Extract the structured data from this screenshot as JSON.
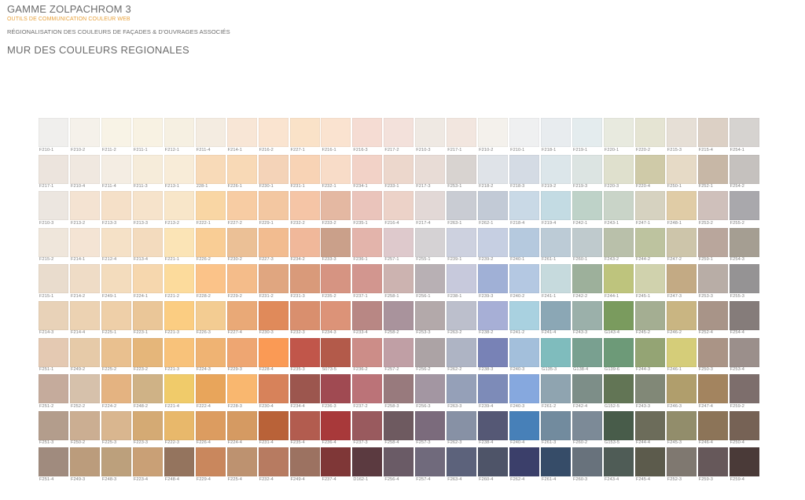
{
  "header": {
    "title": "GAMME ZOLPACHROM 3",
    "subtitle": "OUTILS DE COMMUNICATION COULEUR WEB",
    "description": "RÉGIONALISATION DES COULEURS DE FAÇADES & D'OUVRAGES ASSOCIÉS"
  },
  "section_title": "MUR DES COULEURS REGIONALES",
  "rows": [
    [
      {
        "code": "F210-1",
        "color": "#f0efed"
      },
      {
        "code": "F210-2",
        "color": "#f5f1ea"
      },
      {
        "code": "F211-2",
        "color": "#f8f3e6"
      },
      {
        "code": "F211-1",
        "color": "#f8f2e3"
      },
      {
        "code": "F212-1",
        "color": "#f6f0e2"
      },
      {
        "code": "F211-4",
        "color": "#f4ece1"
      },
      {
        "code": "F214-1",
        "color": "#f8e6d6"
      },
      {
        "code": "F216-2",
        "color": "#fae4d0"
      },
      {
        "code": "F227-1",
        "color": "#fae2c8"
      },
      {
        "code": "F216-1",
        "color": "#fae3d0"
      },
      {
        "code": "F216-3",
        "color": "#f5dcd3"
      },
      {
        "code": "F217-2",
        "color": "#f3e1db"
      },
      {
        "code": "F210-3",
        "color": "#efe9e3"
      },
      {
        "code": "F217-1",
        "color": "#f2e6df"
      },
      {
        "code": "F210-2",
        "color": "#f4f1ec"
      },
      {
        "code": "F210-1",
        "color": "#eff0f1"
      },
      {
        "code": "F218-1",
        "color": "#e8ecef"
      },
      {
        "code": "F219-1",
        "color": "#e4ecee"
      },
      {
        "code": "F220-1",
        "color": "#e8eadf"
      },
      {
        "code": "F220-2",
        "color": "#e5e4d3"
      },
      {
        "code": "F215-3",
        "color": "#e6dfd6"
      },
      {
        "code": "F215-4",
        "color": "#dcd0c5"
      },
      {
        "code": "F254-1",
        "color": "#d6d3d0"
      }
    ],
    [
      {
        "code": "F217-1",
        "color": "#ece4dd"
      },
      {
        "code": "F210-4",
        "color": "#f0e8e0"
      },
      {
        "code": "F211-4",
        "color": "#f4ede3"
      },
      {
        "code": "F211-3",
        "color": "#f6ecda"
      },
      {
        "code": "F213-1",
        "color": "#f8ecd8"
      },
      {
        "code": "228-1",
        "color": "#f8dab8"
      },
      {
        "code": "F226-1",
        "color": "#f8d9b6"
      },
      {
        "code": "F230-1",
        "color": "#f4d3b8"
      },
      {
        "code": "F231-1",
        "color": "#f8d3b5"
      },
      {
        "code": "F232-1",
        "color": "#f8dcc8"
      },
      {
        "code": "F234-1",
        "color": "#f2d2c7"
      },
      {
        "code": "F233-1",
        "color": "#ecd7cc"
      },
      {
        "code": "F217-3",
        "color": "#e8dcd6"
      },
      {
        "code": "F253-1",
        "color": "#d8d3d0"
      },
      {
        "code": "F218-2",
        "color": "#dfe3e8"
      },
      {
        "code": "F218-3",
        "color": "#d4dbe4"
      },
      {
        "code": "F219-2",
        "color": "#dce6ea"
      },
      {
        "code": "F219-3",
        "color": "#dce4e2"
      },
      {
        "code": "F220-3",
        "color": "#dfe0cd"
      },
      {
        "code": "F220-4",
        "color": "#cfcaa8"
      },
      {
        "code": "F250-1",
        "color": "#e6dac6"
      },
      {
        "code": "F252-1",
        "color": "#c7b7a6"
      },
      {
        "code": "F254-2",
        "color": "#c5c1be"
      }
    ],
    [
      {
        "code": "F210-3",
        "color": "#ece6e0"
      },
      {
        "code": "F213-2",
        "color": "#f4e3d2"
      },
      {
        "code": "F213-3",
        "color": "#f5e0c8"
      },
      {
        "code": "F213-3",
        "color": "#f6e3cb"
      },
      {
        "code": "F213-2",
        "color": "#f8e6c9"
      },
      {
        "code": "F222-1",
        "color": "#f9d6a4"
      },
      {
        "code": "F227-2",
        "color": "#f7cca3"
      },
      {
        "code": "F229-1",
        "color": "#f3c7a1"
      },
      {
        "code": "F232-2",
        "color": "#f5c5a6"
      },
      {
        "code": "F233-2",
        "color": "#e4b8a2"
      },
      {
        "code": "F235-1",
        "color": "#eac4bb"
      },
      {
        "code": "F216-4",
        "color": "#ecd2c8"
      },
      {
        "code": "F217-4",
        "color": "#e2d8d6"
      },
      {
        "code": "F263-1",
        "color": "#c9ccd3"
      },
      {
        "code": "F262-1",
        "color": "#c2cad6"
      },
      {
        "code": "F218-4",
        "color": "#c9d9e6"
      },
      {
        "code": "F219-4",
        "color": "#c3dbe3"
      },
      {
        "code": "F242-1",
        "color": "#bed2c8"
      },
      {
        "code": "F243-1",
        "color": "#c9d4c8"
      },
      {
        "code": "F247-1",
        "color": "#d6d2c0"
      },
      {
        "code": "F248-1",
        "color": "#e0cca6"
      },
      {
        "code": "F253-2",
        "color": "#cfc0bb"
      },
      {
        "code": "F255-2",
        "color": "#a9a8ac"
      }
    ],
    [
      {
        "code": "F215-2",
        "color": "#efe6db"
      },
      {
        "code": "F214-1",
        "color": "#f4e4d4"
      },
      {
        "code": "F212-4",
        "color": "#f5e1c7"
      },
      {
        "code": "F213-4",
        "color": "#f3dbbe"
      },
      {
        "code": "F221-1",
        "color": "#fbe4b6"
      },
      {
        "code": "F226-2",
        "color": "#f9cd95"
      },
      {
        "code": "F230-2",
        "color": "#ebc096"
      },
      {
        "code": "F227-3",
        "color": "#f2bc90"
      },
      {
        "code": "F234-2",
        "color": "#f0b89a"
      },
      {
        "code": "F233-3",
        "color": "#caa08a"
      },
      {
        "code": "F236-1",
        "color": "#e3b4ab"
      },
      {
        "code": "F257-1",
        "color": "#dec9cc"
      },
      {
        "code": "F255-1",
        "color": "#d5d2d4"
      },
      {
        "code": "F239-1",
        "color": "#cdd1df"
      },
      {
        "code": "F239-2",
        "color": "#c6cfe2"
      },
      {
        "code": "F240-1",
        "color": "#b5c9de"
      },
      {
        "code": "F261-1",
        "color": "#bccbd6"
      },
      {
        "code": "F260-1",
        "color": "#bfcacd"
      },
      {
        "code": "F243-2",
        "color": "#b9c0aa"
      },
      {
        "code": "F244-2",
        "color": "#bdc39f"
      },
      {
        "code": "F247-2",
        "color": "#cdc5aa"
      },
      {
        "code": "F259-1",
        "color": "#b9a69c"
      },
      {
        "code": "F254-3",
        "color": "#a59e92"
      }
    ],
    [
      {
        "code": "F215-1",
        "color": "#e9dccd"
      },
      {
        "code": "F214-2",
        "color": "#efdcc6"
      },
      {
        "code": "F249-1",
        "color": "#f3dcbd"
      },
      {
        "code": "F224-1",
        "color": "#f6d7ae"
      },
      {
        "code": "F221-2",
        "color": "#fcdb9c"
      },
      {
        "code": "F228-2",
        "color": "#fbc389"
      },
      {
        "code": "F229-2",
        "color": "#f4bc8a"
      },
      {
        "code": "F231-2",
        "color": "#e0a680"
      },
      {
        "code": "F231-3",
        "color": "#d99a7a"
      },
      {
        "code": "F235-2",
        "color": "#d69482"
      },
      {
        "code": "F237-1",
        "color": "#d2968f"
      },
      {
        "code": "F258-1",
        "color": "#ccb3b0"
      },
      {
        "code": "F256-1",
        "color": "#b8b0b4"
      },
      {
        "code": "F238-1",
        "color": "#c7c9dc"
      },
      {
        "code": "F239-3",
        "color": "#a0b0d6"
      },
      {
        "code": "F240-2",
        "color": "#b4c8e2"
      },
      {
        "code": "F241-1",
        "color": "#c6dadd"
      },
      {
        "code": "F242-2",
        "color": "#9db09b"
      },
      {
        "code": "F244-1",
        "color": "#bec47d"
      },
      {
        "code": "F245-1",
        "color": "#d0d2ad"
      },
      {
        "code": "F247-3",
        "color": "#c3aa84"
      },
      {
        "code": "F253-3",
        "color": "#b8ada6"
      },
      {
        "code": "F255-3",
        "color": "#959394"
      }
    ],
    [
      {
        "code": "F214-3",
        "color": "#e8d2b8"
      },
      {
        "code": "F214-4",
        "color": "#ecd2b2"
      },
      {
        "code": "F225-1",
        "color": "#eecfa8"
      },
      {
        "code": "F223-1",
        "color": "#eac698"
      },
      {
        "code": "F221-3",
        "color": "#fbcd82"
      },
      {
        "code": "F226-3",
        "color": "#f3cc92"
      },
      {
        "code": "F227-4",
        "color": "#e9a977"
      },
      {
        "code": "F230-3",
        "color": "#e08a5a"
      },
      {
        "code": "F232-3",
        "color": "#d98f6e"
      },
      {
        "code": "F234-3",
        "color": "#dc9378"
      },
      {
        "code": "F233-4",
        "color": "#b88784"
      },
      {
        "code": "F258-2",
        "color": "#a9939c"
      },
      {
        "code": "F253-3",
        "color": "#b3a9aa"
      },
      {
        "code": "F263-2",
        "color": "#bcbfcc"
      },
      {
        "code": "F238-2",
        "color": "#a7afd6"
      },
      {
        "code": "F241-2",
        "color": "#a9d1e0"
      },
      {
        "code": "F241-4",
        "color": "#8ba7b5"
      },
      {
        "code": "F243-3",
        "color": "#9bb0aa"
      },
      {
        "code": "G143-4",
        "color": "#7a9b5e"
      },
      {
        "code": "F245-2",
        "color": "#a4ae92"
      },
      {
        "code": "F246-2",
        "color": "#c9b582"
      },
      {
        "code": "F252-4",
        "color": "#a89488"
      },
      {
        "code": "F254-4",
        "color": "#857c7a"
      }
    ],
    [
      {
        "code": "F251-1",
        "color": "#e4c9b2"
      },
      {
        "code": "F249-2",
        "color": "#e6caa8"
      },
      {
        "code": "F225-2",
        "color": "#e9c08f"
      },
      {
        "code": "F223-2",
        "color": "#e5b67a"
      },
      {
        "code": "F221-3",
        "color": "#f8c27a"
      },
      {
        "code": "F224-3",
        "color": "#efb373"
      },
      {
        "code": "F229-3",
        "color": "#eea672"
      },
      {
        "code": "F228-4",
        "color": "#fa9a55"
      },
      {
        "code": "F235-3",
        "color": "#c1564a"
      },
      {
        "code": "S073-5",
        "color": "#b35a4a"
      },
      {
        "code": "F236-2",
        "color": "#cc8d88"
      },
      {
        "code": "F257-2",
        "color": "#c09fa5"
      },
      {
        "code": "F256-2",
        "color": "#aca3a5"
      },
      {
        "code": "F262-2",
        "color": "#aeb4c4"
      },
      {
        "code": "F238-3",
        "color": "#7882b6"
      },
      {
        "code": "F240-3",
        "color": "#a3bfdb"
      },
      {
        "code": "G135-3",
        "color": "#7fbcbd"
      },
      {
        "code": "G138-4",
        "color": "#79a090"
      },
      {
        "code": "G139-6",
        "color": "#6d9a78"
      },
      {
        "code": "F244-3",
        "color": "#94a474"
      },
      {
        "code": "F246-1",
        "color": "#d5cd79"
      },
      {
        "code": "F250-3",
        "color": "#aa9486"
      },
      {
        "code": "F253-4",
        "color": "#9b8f8b"
      }
    ],
    [
      {
        "code": "F251-2",
        "color": "#c5ab9c"
      },
      {
        "code": "F252-2",
        "color": "#d6c1ab"
      },
      {
        "code": "F224-2",
        "color": "#e4b381"
      },
      {
        "code": "F248-2",
        "color": "#cfb286"
      },
      {
        "code": "F221-4",
        "color": "#f0cb6a"
      },
      {
        "code": "F222-4",
        "color": "#e8a55b"
      },
      {
        "code": "F228-3",
        "color": "#f9b76f"
      },
      {
        "code": "F230-4",
        "color": "#d7825a"
      },
      {
        "code": "F234-4",
        "color": "#9c564e"
      },
      {
        "code": "F236-3",
        "color": "#a04a52"
      },
      {
        "code": "F237-2",
        "color": "#bb7378"
      },
      {
        "code": "F258-3",
        "color": "#987a7d"
      },
      {
        "code": "F256-3",
        "color": "#a396a2"
      },
      {
        "code": "F263-3",
        "color": "#95a0b8"
      },
      {
        "code": "F239-4",
        "color": "#7d8bb8"
      },
      {
        "code": "F240-3",
        "color": "#86a8de"
      },
      {
        "code": "F261-2",
        "color": "#8fa4b0"
      },
      {
        "code": "F242-4",
        "color": "#7d8e88"
      },
      {
        "code": "G152-5",
        "color": "#627555"
      },
      {
        "code": "F243-3",
        "color": "#818877"
      },
      {
        "code": "F246-3",
        "color": "#b09e6c"
      },
      {
        "code": "F247-4",
        "color": "#a3845f"
      },
      {
        "code": "F259-2",
        "color": "#7d6e6c"
      }
    ],
    [
      {
        "code": "F251-3",
        "color": "#b39d8c"
      },
      {
        "code": "F250-2",
        "color": "#cbae92"
      },
      {
        "code": "F225-3",
        "color": "#d9b68f"
      },
      {
        "code": "F223-3",
        "color": "#d4aa74"
      },
      {
        "code": "F222-3",
        "color": "#e8b86b"
      },
      {
        "code": "F226-4",
        "color": "#dc9c60"
      },
      {
        "code": "F224-4",
        "color": "#d59a62"
      },
      {
        "code": "F231-4",
        "color": "#b96238"
      },
      {
        "code": "F235-4",
        "color": "#b25c4f"
      },
      {
        "code": "F236-4",
        "color": "#a8393a"
      },
      {
        "code": "F237-3",
        "color": "#995a5e"
      },
      {
        "code": "F258-4",
        "color": "#6e5a60"
      },
      {
        "code": "F257-3",
        "color": "#7b6b7c"
      },
      {
        "code": "F262-3",
        "color": "#8791a5"
      },
      {
        "code": "F238-4",
        "color": "#555875"
      },
      {
        "code": "F240-4",
        "color": "#4780b8"
      },
      {
        "code": "F261-3",
        "color": "#728b9e"
      },
      {
        "code": "F260-2",
        "color": "#7c8a97"
      },
      {
        "code": "G153-5",
        "color": "#485c4a"
      },
      {
        "code": "F244-4",
        "color": "#6c6c5a"
      },
      {
        "code": "F245-3",
        "color": "#928d6b"
      },
      {
        "code": "F246-4",
        "color": "#8c7458"
      },
      {
        "code": "F250-4",
        "color": "#766255"
      }
    ],
    [
      {
        "code": "F251-4",
        "color": "#a08b7e"
      },
      {
        "code": "F249-3",
        "color": "#bb9c7c"
      },
      {
        "code": "F248-3",
        "color": "#bca07c"
      },
      {
        "code": "F223-4",
        "color": "#c9a076"
      },
      {
        "code": "F248-4",
        "color": "#94745e"
      },
      {
        "code": "F229-4",
        "color": "#c9875d"
      },
      {
        "code": "F225-4",
        "color": "#bd9270"
      },
      {
        "code": "F232-4",
        "color": "#b77b61"
      },
      {
        "code": "F249-4",
        "color": "#9c7261"
      },
      {
        "code": "F237-4",
        "color": "#7f3737"
      },
      {
        "code": "D162-1",
        "color": "#5b3a40"
      },
      {
        "code": "F256-4",
        "color": "#6a5b66"
      },
      {
        "code": "F257-4",
        "color": "#706a7c"
      },
      {
        "code": "F263-4",
        "color": "#5c627b"
      },
      {
        "code": "F260-4",
        "color": "#4e5468"
      },
      {
        "code": "F262-4",
        "color": "#3b3f6a"
      },
      {
        "code": "F261-4",
        "color": "#364c68"
      },
      {
        "code": "F260-3",
        "color": "#68727c"
      },
      {
        "code": "F243-4",
        "color": "#4f5c56"
      },
      {
        "code": "F245-4",
        "color": "#5c5b4c"
      },
      {
        "code": "F252-3",
        "color": "#7f7870"
      },
      {
        "code": "F259-3",
        "color": "#66585a"
      },
      {
        "code": "F259-4",
        "color": "#4a3a38"
      }
    ]
  ]
}
